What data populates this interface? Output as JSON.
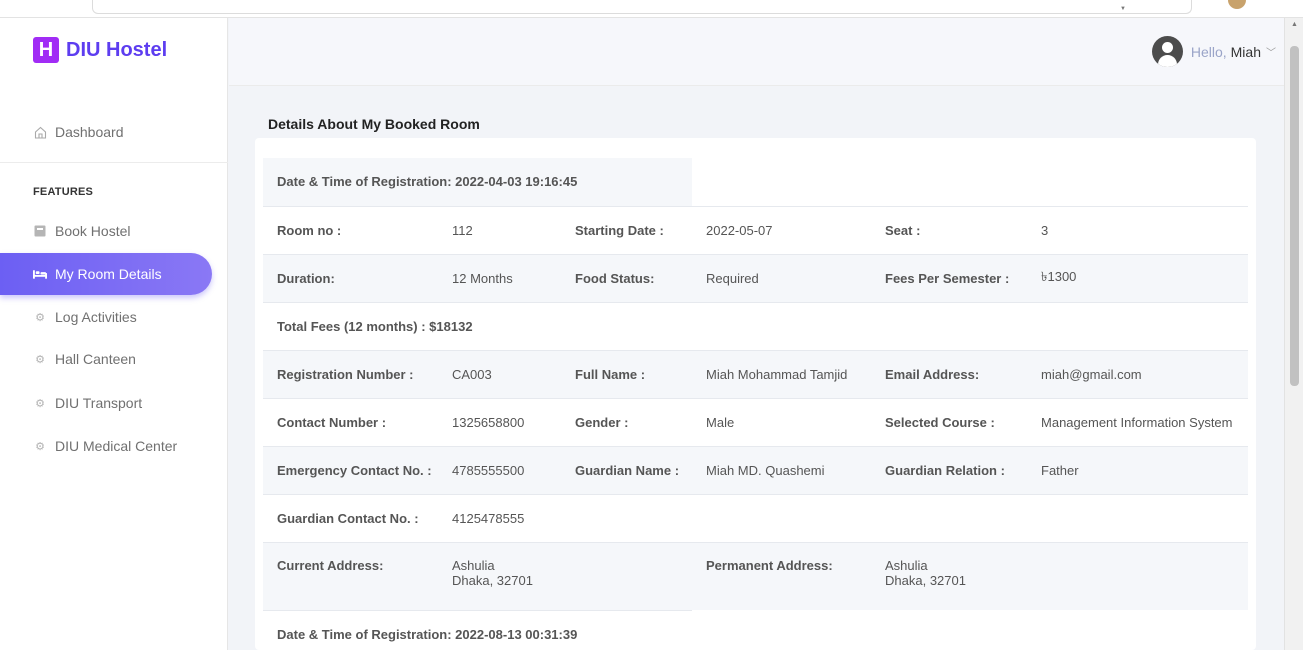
{
  "brand": {
    "logo_letter": "H",
    "name": "DIU Hostel",
    "color": "#5d3df0",
    "logo_color": "#a12cf5"
  },
  "sidebar": {
    "dashboard": {
      "label": "Dashboard",
      "icon": "home-icon"
    },
    "section_label": "FEATURES",
    "items": [
      {
        "label": "Book Hostel",
        "icon": "book-icon",
        "active": false
      },
      {
        "label": "My Room Details",
        "icon": "bed-icon",
        "active": true
      },
      {
        "label": "Log Activities",
        "icon": "cogs-icon",
        "active": false
      },
      {
        "label": "Hall Canteen",
        "icon": "cogs-icon",
        "active": false
      },
      {
        "label": "DIU Transport",
        "icon": "cogs-icon",
        "active": false
      },
      {
        "label": "DIU Medical Center",
        "icon": "cogs-icon",
        "active": false
      }
    ],
    "active_color": "#6c5ff3"
  },
  "header": {
    "greeting": "Hello,",
    "user_name": "Miah",
    "avatar_icon": "user-avatar-icon"
  },
  "main": {
    "title": "Details About My Booked Room",
    "record": {
      "registration_datetime": "Date & Time of Registration: 2022-04-03 19:16:45",
      "room_no_label": "Room no :",
      "room_no": "112",
      "starting_date_label": "Starting Date :",
      "starting_date": "2022-05-07",
      "seat_label": "Seat :",
      "seat": "3",
      "duration_label": "Duration:",
      "duration": "12 Months",
      "food_status_label": "Food Status:",
      "food_status": "Required",
      "fees_label": "Fees Per Semester :",
      "fees": "৳1300",
      "total_fees": "Total Fees (12 months) : $18132",
      "reg_number_label": "Registration Number :",
      "reg_number": "CA003",
      "full_name_label": "Full Name :",
      "full_name": "Miah Mohammad Tamjid",
      "email_label": "Email Address:",
      "email": "miah@gmail.com",
      "contact_label": "Contact Number :",
      "contact": "1325658800",
      "gender_label": "Gender :",
      "gender": "Male",
      "course_label": "Selected Course :",
      "course": "Management Information System",
      "emergency_label": "Emergency Contact No. :",
      "emergency": "4785555500",
      "guardian_name_label": "Guardian Name :",
      "guardian_name": "Miah MD. Quashemi",
      "guardian_relation_label": "Guardian Relation :",
      "guardian_relation": "Father",
      "guardian_contact_label": "Guardian Contact No. :",
      "guardian_contact": "4125478555",
      "current_address_label": "Current Address:",
      "current_address_line1": "Ashulia",
      "current_address_line2": "Dhaka, 32701",
      "permanent_address_label": "Permanent Address:",
      "permanent_address_line1": "Ashulia",
      "permanent_address_line2": "Dhaka, 32701"
    },
    "next_registration_datetime": "Date & Time of Registration: 2022-08-13 00:31:39"
  }
}
